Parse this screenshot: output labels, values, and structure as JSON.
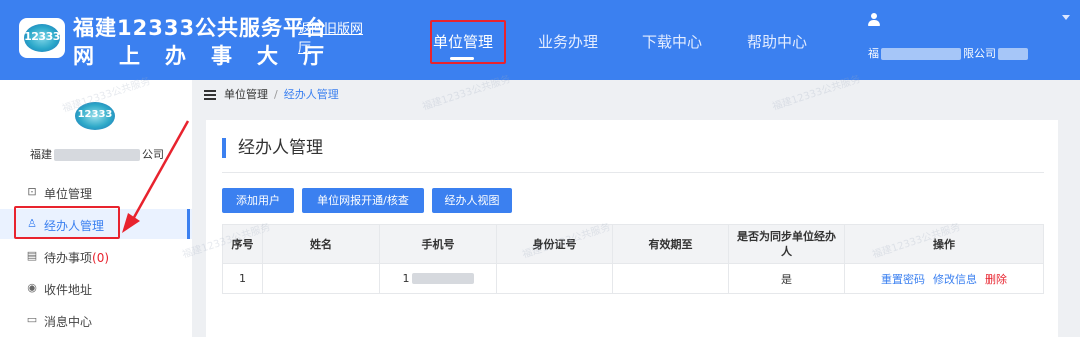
{
  "header": {
    "logo_text": "12333",
    "title_line1": "福建12333公共服务平台",
    "title_line2": "网上办事大厅",
    "old_version_link": "返回旧版网厅",
    "nav": [
      {
        "label": "单位管理",
        "active": true
      },
      {
        "label": "业务办理",
        "active": false
      },
      {
        "label": "下载中心",
        "active": false
      },
      {
        "label": "帮助中心",
        "active": false
      }
    ],
    "user_company_prefix": "福",
    "user_company_suffix": "限公司",
    "accent_color": "#3b80f0"
  },
  "sidebar": {
    "logo_text": "12333",
    "company_prefix": "福建",
    "company_suffix": "公司",
    "items": [
      {
        "icon": "unit-icon",
        "label": "单位管理",
        "active": false
      },
      {
        "icon": "user-icon",
        "label": "经办人管理",
        "active": true
      },
      {
        "icon": "todo-icon",
        "label": "待办事项",
        "count": "(0)",
        "active": false
      },
      {
        "icon": "location-icon",
        "label": "收件地址",
        "active": false
      },
      {
        "icon": "message-icon",
        "label": "消息中心",
        "active": false
      }
    ]
  },
  "breadcrumb": {
    "root": "单位管理",
    "separator": "/",
    "current": "经办人管理"
  },
  "main": {
    "title": "经办人管理",
    "buttons": [
      "添加用户",
      "单位网报开通/核查",
      "经办人视图"
    ],
    "table": {
      "headers": [
        "序号",
        "姓名",
        "手机号",
        "身份证号",
        "有效期至",
        "是否为同步单位经办人",
        "操作"
      ],
      "rows": [
        {
          "index": "1",
          "name": "",
          "phone_prefix": "1",
          "id_number": "",
          "valid_until": "",
          "synced": "是"
        }
      ],
      "actions": [
        "重置密码",
        "修改信息",
        "删除"
      ]
    }
  },
  "watermark_text": "福建12333公共服务"
}
